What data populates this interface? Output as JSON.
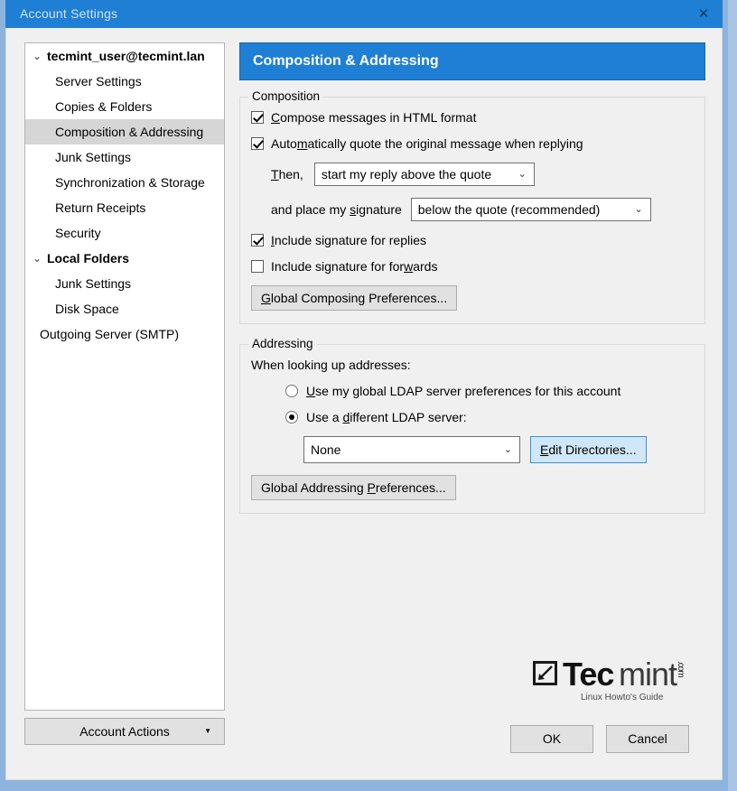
{
  "window": {
    "title": "Account Settings",
    "close_label": "✕",
    "accent_color": "#1e7fd4",
    "frame_color": "#8cb4dd"
  },
  "sidebar": {
    "items": [
      {
        "label": "tecmint_user@tecmint.lan",
        "level": "root",
        "twisty": "⌄",
        "selected": false
      },
      {
        "label": "Server Settings",
        "level": "child",
        "twisty": "",
        "selected": false
      },
      {
        "label": "Copies & Folders",
        "level": "child",
        "twisty": "",
        "selected": false
      },
      {
        "label": "Composition & Addressing",
        "level": "child",
        "twisty": "",
        "selected": true
      },
      {
        "label": "Junk Settings",
        "level": "child",
        "twisty": "",
        "selected": false
      },
      {
        "label": "Synchronization & Storage",
        "level": "child",
        "twisty": "",
        "selected": false
      },
      {
        "label": "Return Receipts",
        "level": "child",
        "twisty": "",
        "selected": false
      },
      {
        "label": "Security",
        "level": "child",
        "twisty": "",
        "selected": false
      },
      {
        "label": "Local Folders",
        "level": "root2",
        "twisty": "⌄",
        "selected": false
      },
      {
        "label": "Junk Settings",
        "level": "child",
        "twisty": "",
        "selected": false
      },
      {
        "label": "Disk Space",
        "level": "child",
        "twisty": "",
        "selected": false
      },
      {
        "label": "Outgoing Server (SMTP)",
        "level": "child2",
        "twisty": "",
        "selected": false
      }
    ],
    "account_actions_label": "Account Actions",
    "account_actions_caret": "▼"
  },
  "pane": {
    "header": "Composition & Addressing",
    "composition": {
      "group_label": "Composition",
      "compose_html_label": "Compose messages in HTML format",
      "compose_html_checked": true,
      "auto_quote_label": "Automatically quote the original message when replying",
      "auto_quote_checked": true,
      "then_label": "Then,",
      "then_value": "start my reply above the quote",
      "signature_place_label": "and place my signature",
      "signature_place_value": "below the quote (recommended)",
      "sig_replies_label": "Include signature for replies",
      "sig_replies_checked": true,
      "sig_forwards_label": "Include signature for forwards",
      "sig_forwards_checked": false,
      "global_composing_button": "Global Composing Preferences...",
      "select_arrow": "⌄"
    },
    "addressing": {
      "group_label": "Addressing",
      "lookup_label": "When looking up addresses:",
      "global_ldap_label": "Use my global LDAP server preferences for this account",
      "global_ldap_selected": false,
      "different_ldap_label": "Use a different LDAP server:",
      "different_ldap_selected": true,
      "server_value": "None",
      "edit_directories_button": "Edit Directories...",
      "global_addressing_button": "Global Addressing Preferences...",
      "select_arrow": "⌄"
    }
  },
  "logo": {
    "word_bold": "Tec",
    "word_light": "mint",
    "suffix": ".com",
    "tagline": "Linux Howto's Guide"
  },
  "footer": {
    "ok_label": "OK",
    "cancel_label": "Cancel"
  }
}
